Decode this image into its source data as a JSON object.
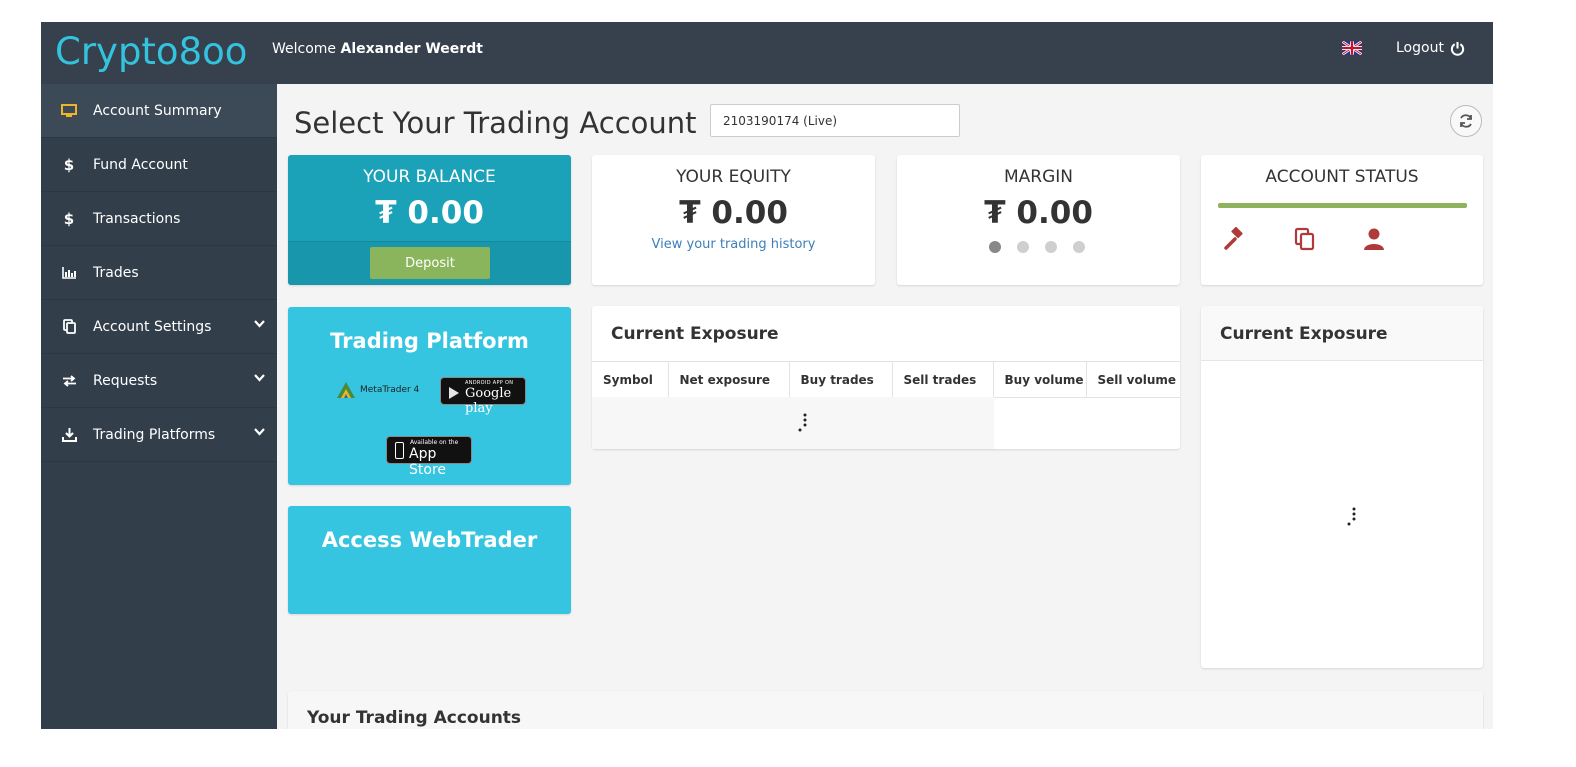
{
  "header": {
    "logo": "Crypto8oo",
    "welcome_prefix": "Welcome ",
    "user_name": "Alexander Weerdt",
    "logout_label": "Logout"
  },
  "sidebar": {
    "items": [
      {
        "label": "Account Summary",
        "icon": "monitor-icon",
        "active": true
      },
      {
        "label": "Fund Account",
        "icon": "dollar-icon"
      },
      {
        "label": "Transactions",
        "icon": "dollar-icon"
      },
      {
        "label": "Trades",
        "icon": "bar-chart-icon"
      },
      {
        "label": "Account Settings",
        "icon": "copy-icon",
        "expandable": true
      },
      {
        "label": "Requests",
        "icon": "exchange-icon",
        "expandable": true
      },
      {
        "label": "Trading Platforms",
        "icon": "download-icon",
        "expandable": true
      }
    ]
  },
  "main": {
    "title": "Select Your Trading Account",
    "account_selected": "2103190174 (Live)",
    "balance": {
      "label": "YOUR BALANCE",
      "value": "₮ 0.00",
      "deposit_label": "Deposit"
    },
    "equity": {
      "label": "YOUR EQUITY",
      "value": "₮ 0.00",
      "history_link": "View your trading history"
    },
    "margin": {
      "label": "MARGIN",
      "value": "₮ 0.00",
      "slides": 4,
      "active_slide": 1
    },
    "status": {
      "label": "ACCOUNT STATUS",
      "icons": [
        "gavel-icon",
        "documents-icon",
        "user-icon"
      ]
    },
    "platform": {
      "title": "Trading Platform",
      "metatrader": "MetaTrader 4",
      "google_small": "ANDROID APP ON",
      "google_big": "Google play",
      "apple_small": "Available on the",
      "apple_big": "App Store"
    },
    "webtrader": {
      "title": "Access WebTrader"
    },
    "exposure": {
      "title": "Current Exposure",
      "columns": [
        "Symbol",
        "Net exposure",
        "Buy trades",
        "Sell trades",
        "Buy volume",
        "Sell volume"
      ]
    },
    "exposure_chart": {
      "title": "Current Exposure"
    },
    "accounts": {
      "title": "Your Trading Accounts"
    }
  },
  "colors": {
    "header_bg": "#36414d",
    "sidebar_bg": "#323e4a",
    "logo": "#34c3de",
    "balance_bg": "#1ba1b8",
    "platform_bg": "#36c5e0",
    "deposit_btn": "#8ab55c",
    "status_bar": "#8fb25c",
    "status_icons": "#b03a3a"
  }
}
